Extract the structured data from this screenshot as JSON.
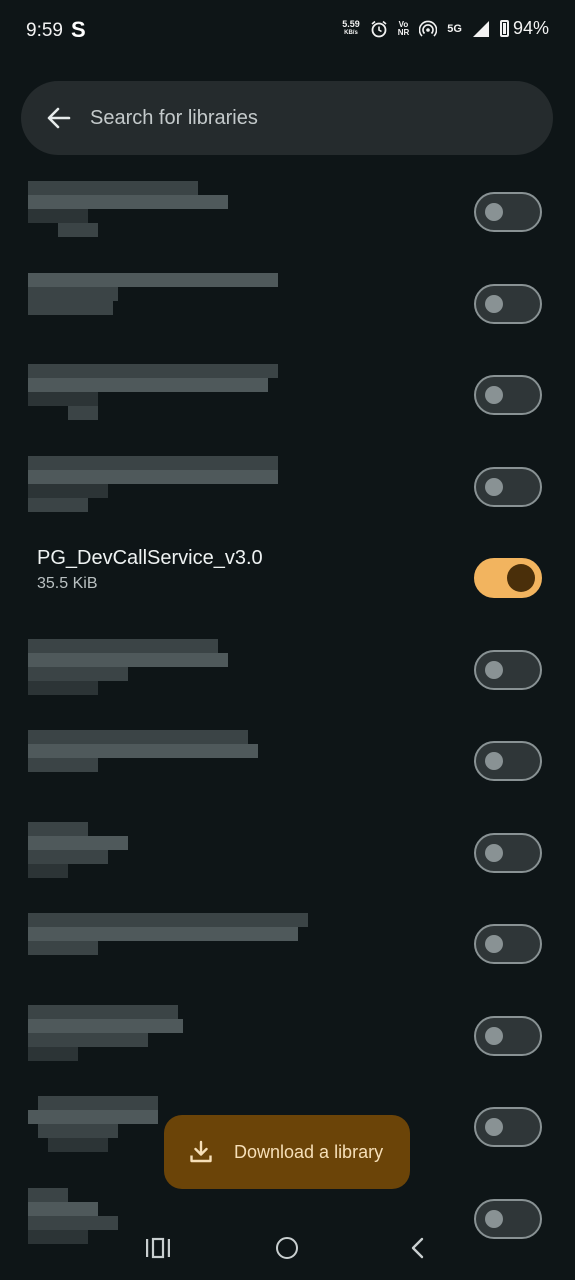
{
  "status_bar": {
    "time": "9:59",
    "app_letter": "S",
    "speed_value": "5.59",
    "speed_unit": "KB/s",
    "volte_top": "Vo",
    "volte_bottom": "NR",
    "network": "5G",
    "battery": "94%"
  },
  "search": {
    "placeholder": "Search for libraries"
  },
  "libraries": [
    {
      "name": "",
      "size": "",
      "enabled": false,
      "redacted": true
    },
    {
      "name": "",
      "size": "",
      "enabled": false,
      "redacted": true
    },
    {
      "name": "",
      "size": "",
      "enabled": false,
      "redacted": true
    },
    {
      "name": "",
      "size": "",
      "enabled": false,
      "redacted": true
    },
    {
      "name": "PG_DevCallService_v3.0",
      "size": "35.5 KiB",
      "enabled": true,
      "redacted": false
    },
    {
      "name": "",
      "size": "",
      "enabled": false,
      "redacted": true
    },
    {
      "name": "",
      "size": "",
      "enabled": false,
      "redacted": true
    },
    {
      "name": "",
      "size": "",
      "enabled": false,
      "redacted": true
    },
    {
      "name": "",
      "size": "",
      "enabled": false,
      "redacted": true
    },
    {
      "name": "",
      "size": "",
      "enabled": false,
      "redacted": true
    },
    {
      "name": "",
      "size": "",
      "enabled": false,
      "redacted": true
    },
    {
      "name": "",
      "size": "",
      "enabled": false,
      "redacted": true
    }
  ],
  "fab": {
    "label": "Download a library",
    "icon": "download-icon"
  },
  "nav": {
    "recents_icon": "recents-icon",
    "home_icon": "home-icon",
    "back_icon": "back-icon"
  },
  "colors": {
    "background": "#0e1517",
    "toggle_on": "#f2b45f",
    "fab": "#6b4408"
  }
}
